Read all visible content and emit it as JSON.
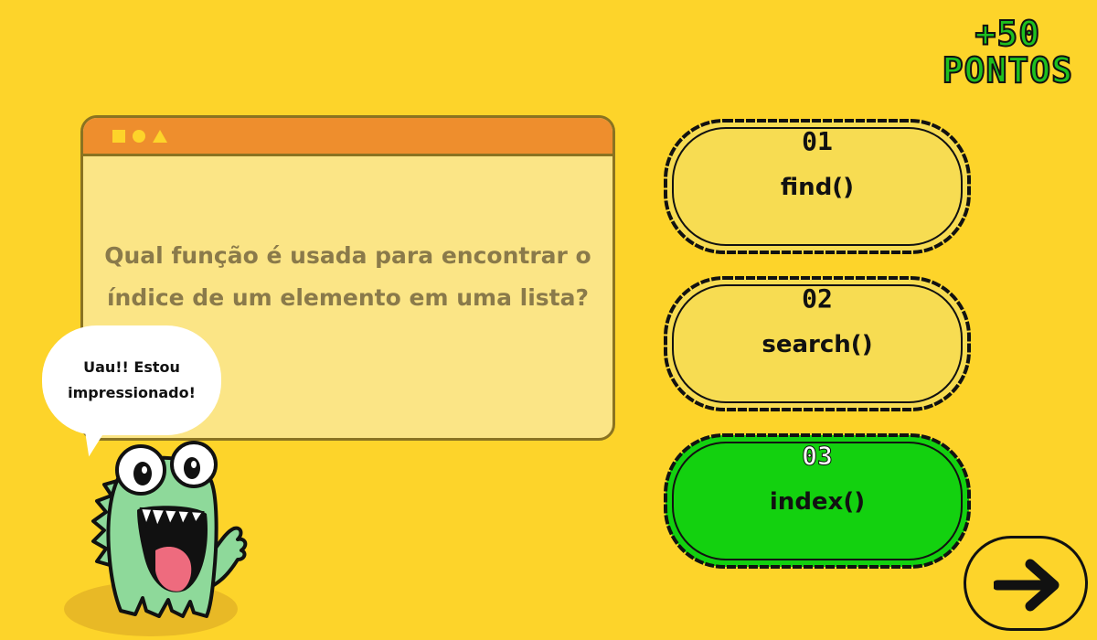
{
  "score": {
    "points": "+50",
    "label": "PONTOS"
  },
  "question": {
    "text": "Qual função é usada para encontrar o índice de um elemento em uma lista?"
  },
  "window": {
    "icons": [
      "square-icon",
      "circle-icon",
      "triangle-icon"
    ]
  },
  "speech": {
    "line1": "Uau!! Estou",
    "line2": "impressionado!"
  },
  "answers": [
    {
      "number": "01",
      "text": "find()",
      "state": "default"
    },
    {
      "number": "02",
      "text": "search()",
      "state": "default"
    },
    {
      "number": "03",
      "text": "index()",
      "state": "correct"
    }
  ],
  "next": {
    "icon": "arrow-right-icon"
  },
  "colors": {
    "background": "#fdd42a",
    "window_bar": "#ee8e2d",
    "window_body": "#fbe586",
    "answer_default": "#f7dc52",
    "answer_correct": "#13d10f",
    "score": "#1ec01e",
    "mascot": "#8ed99a"
  }
}
